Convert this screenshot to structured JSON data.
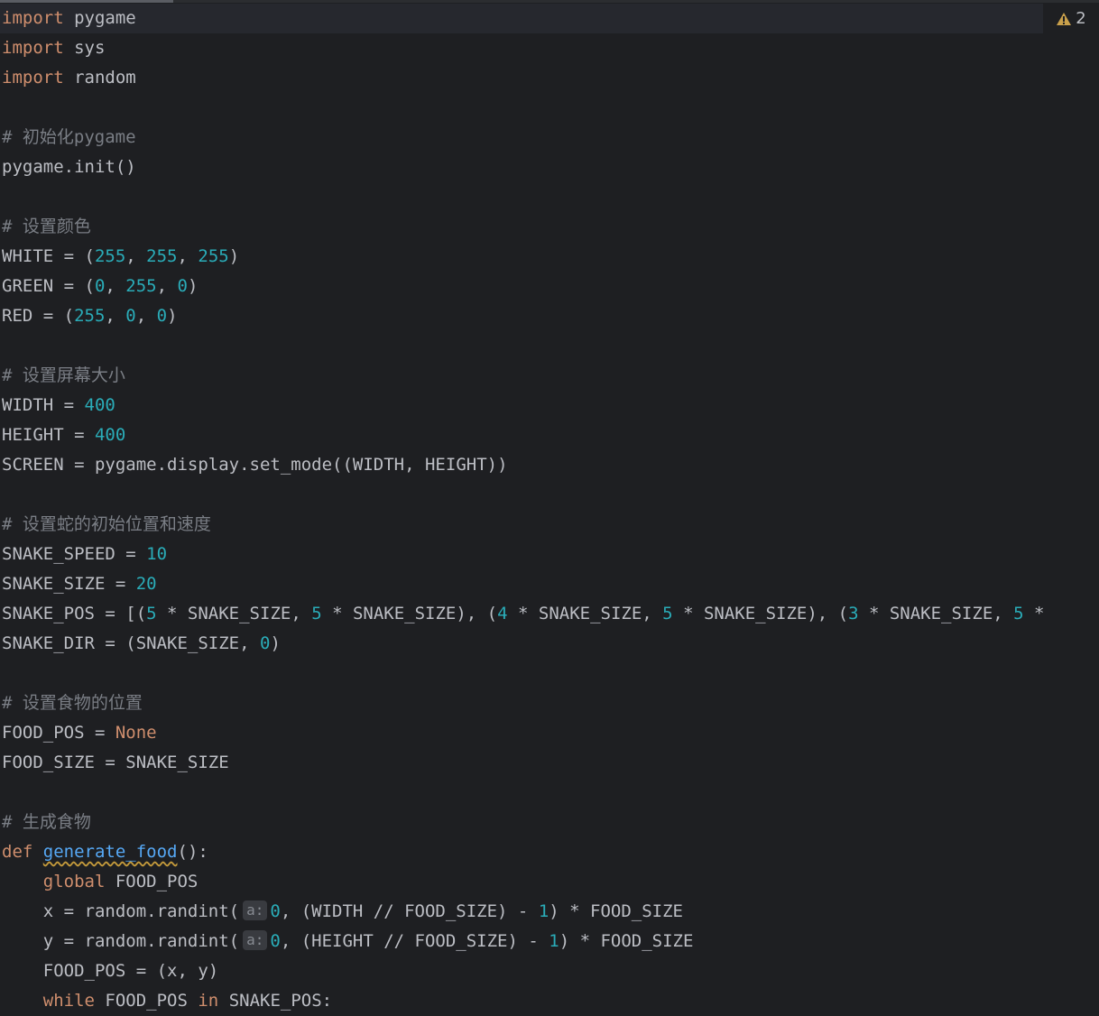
{
  "editor": {
    "warning_count": "2",
    "lines": [
      [
        {
          "t": "import",
          "c": "kw"
        },
        {
          "t": " pygame"
        }
      ],
      [
        {
          "t": "import",
          "c": "kw"
        },
        {
          "t": " sys"
        }
      ],
      [
        {
          "t": "import",
          "c": "kw"
        },
        {
          "t": " random"
        }
      ],
      [],
      [
        {
          "t": "# 初始化pygame",
          "c": "cm"
        }
      ],
      [
        {
          "t": "pygame.init()"
        }
      ],
      [],
      [
        {
          "t": "# 设置颜色",
          "c": "cm"
        }
      ],
      [
        {
          "t": "WHITE = ("
        },
        {
          "t": "255",
          "c": "num"
        },
        {
          "t": ", "
        },
        {
          "t": "255",
          "c": "num"
        },
        {
          "t": ", "
        },
        {
          "t": "255",
          "c": "num"
        },
        {
          "t": ")"
        }
      ],
      [
        {
          "t": "GREEN = ("
        },
        {
          "t": "0",
          "c": "num"
        },
        {
          "t": ", "
        },
        {
          "t": "255",
          "c": "num"
        },
        {
          "t": ", "
        },
        {
          "t": "0",
          "c": "num"
        },
        {
          "t": ")"
        }
      ],
      [
        {
          "t": "RED = ("
        },
        {
          "t": "255",
          "c": "num"
        },
        {
          "t": ", "
        },
        {
          "t": "0",
          "c": "num"
        },
        {
          "t": ", "
        },
        {
          "t": "0",
          "c": "num"
        },
        {
          "t": ")"
        }
      ],
      [],
      [
        {
          "t": "# 设置屏幕大小",
          "c": "cm"
        }
      ],
      [
        {
          "t": "WIDTH = "
        },
        {
          "t": "400",
          "c": "num"
        }
      ],
      [
        {
          "t": "HEIGHT = "
        },
        {
          "t": "400",
          "c": "num"
        }
      ],
      [
        {
          "t": "SCREEN = pygame.display.set_mode((WIDTH, HEIGHT))"
        }
      ],
      [],
      [
        {
          "t": "# 设置蛇的初始位置和速度",
          "c": "cm"
        }
      ],
      [
        {
          "t": "SNAKE_SPEED = "
        },
        {
          "t": "10",
          "c": "num"
        }
      ],
      [
        {
          "t": "SNAKE_SIZE = "
        },
        {
          "t": "20",
          "c": "num"
        }
      ],
      [
        {
          "t": "SNAKE_POS = [("
        },
        {
          "t": "5",
          "c": "num"
        },
        {
          "t": " * SNAKE_SIZE, "
        },
        {
          "t": "5",
          "c": "num"
        },
        {
          "t": " * SNAKE_SIZE), ("
        },
        {
          "t": "4",
          "c": "num"
        },
        {
          "t": " * SNAKE_SIZE, "
        },
        {
          "t": "5",
          "c": "num"
        },
        {
          "t": " * SNAKE_SIZE), ("
        },
        {
          "t": "3",
          "c": "num"
        },
        {
          "t": " * SNAKE_SIZE, "
        },
        {
          "t": "5",
          "c": "num"
        },
        {
          "t": " *"
        }
      ],
      [
        {
          "t": "SNAKE_DIR = (SNAKE_SIZE, "
        },
        {
          "t": "0",
          "c": "num"
        },
        {
          "t": ")"
        }
      ],
      [],
      [
        {
          "t": "# 设置食物的位置",
          "c": "cm"
        }
      ],
      [
        {
          "t": "FOOD_POS = "
        },
        {
          "t": "None",
          "c": "kw"
        }
      ],
      [
        {
          "t": "FOOD_SIZE = SNAKE_SIZE"
        }
      ],
      [],
      [
        {
          "t": "# 生成食物",
          "c": "cm"
        }
      ],
      [
        {
          "t": "def",
          "c": "kw"
        },
        {
          "t": " "
        },
        {
          "t": "generate_food",
          "c": "fn"
        },
        {
          "t": "():"
        }
      ],
      [
        {
          "t": "    "
        },
        {
          "t": "global",
          "c": "kw"
        },
        {
          "t": " FOOD_POS"
        }
      ],
      [
        {
          "t": "    x = random.randint("
        },
        {
          "t": "a:",
          "c": "hint"
        },
        {
          "t": "0",
          "c": "num"
        },
        {
          "t": ", (WIDTH // FOOD_SIZE) - "
        },
        {
          "t": "1",
          "c": "num"
        },
        {
          "t": ") * FOOD_SIZE"
        }
      ],
      [
        {
          "t": "    y = random.randint("
        },
        {
          "t": "a:",
          "c": "hint"
        },
        {
          "t": "0",
          "c": "num"
        },
        {
          "t": ", (HEIGHT // FOOD_SIZE) - "
        },
        {
          "t": "1",
          "c": "num"
        },
        {
          "t": ") * FOOD_SIZE"
        }
      ],
      [
        {
          "t": "    FOOD_POS = (x, y)"
        }
      ],
      [
        {
          "t": "    "
        },
        {
          "t": "while",
          "c": "kw"
        },
        {
          "t": " FOOD_POS "
        },
        {
          "t": "in",
          "c": "kw"
        },
        {
          "t": " SNAKE_POS:"
        }
      ]
    ]
  }
}
